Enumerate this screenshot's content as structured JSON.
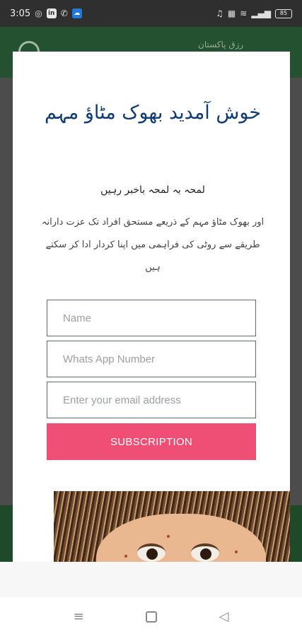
{
  "status_bar": {
    "time": "3:05",
    "left_icons": [
      "instagram-icon",
      "linkedin-icon",
      "phone-icon",
      "cloud-app-icon"
    ],
    "right_icons": [
      "headset-icon",
      "volte-icon",
      "wifi-icon",
      "signal-icon"
    ],
    "battery": "85"
  },
  "background_app": {
    "logo_text": "رزق پاکستان"
  },
  "modal": {
    "title": "خوش آمدید بھوک مٹاؤ مہم",
    "subtitle": "لمحہ بہ لمحہ باخبر رہیں",
    "description": "اور بھوک مٹاؤ مہم کے ذریعے مستحق افراد تک عزت دارانہ طریقے سے روٹی کی فراہمی میں اپنا کردار ادا کر سکتے ہیں",
    "fields": {
      "name_placeholder": "Name",
      "whatsapp_placeholder": "Whats App Number",
      "email_placeholder": "Enter your email address"
    },
    "subscribe_label": "SUBSCRIPTION"
  },
  "nav_bar": {
    "recents_icon": "menu-lines-icon",
    "home_icon": "square-home-icon",
    "back_icon": "triangle-back-icon"
  }
}
